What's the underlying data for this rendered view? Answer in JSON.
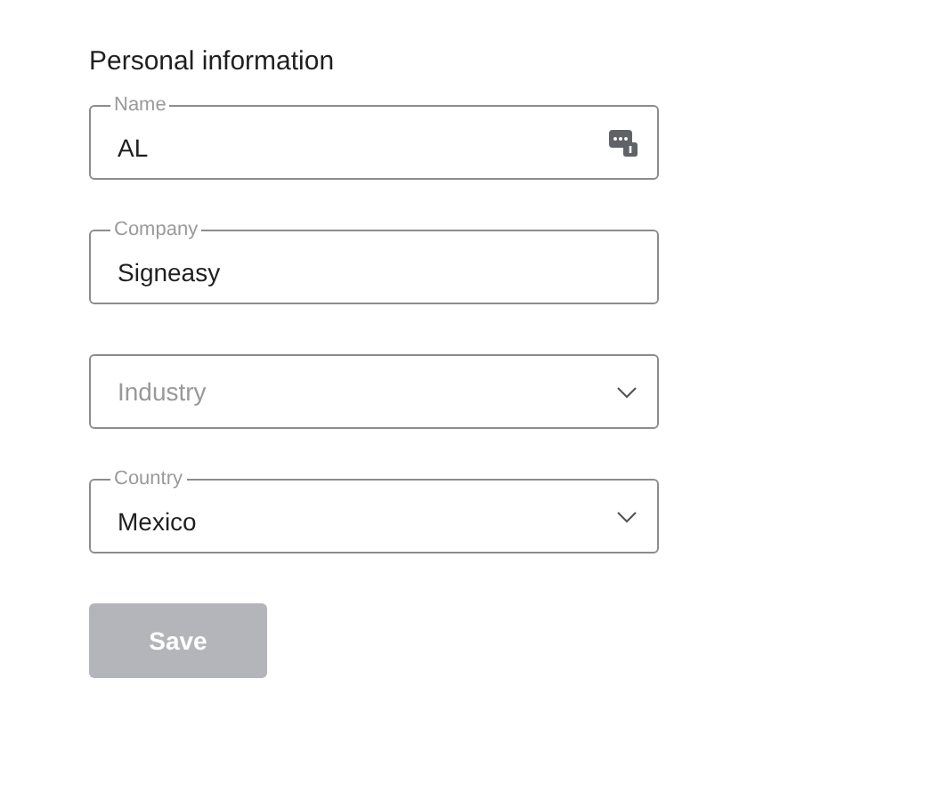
{
  "heading": "Personal information",
  "fields": [
    {
      "kind": "text",
      "label": "Name",
      "value": "AL",
      "autofill_icon": true
    },
    {
      "kind": "text",
      "label": "Company",
      "value": "Signeasy"
    },
    {
      "kind": "select",
      "placeholder": "Industry"
    },
    {
      "kind": "select",
      "label": "Country",
      "value": "Mexico"
    }
  ],
  "save_button": {
    "label": "Save",
    "disabled": true
  }
}
